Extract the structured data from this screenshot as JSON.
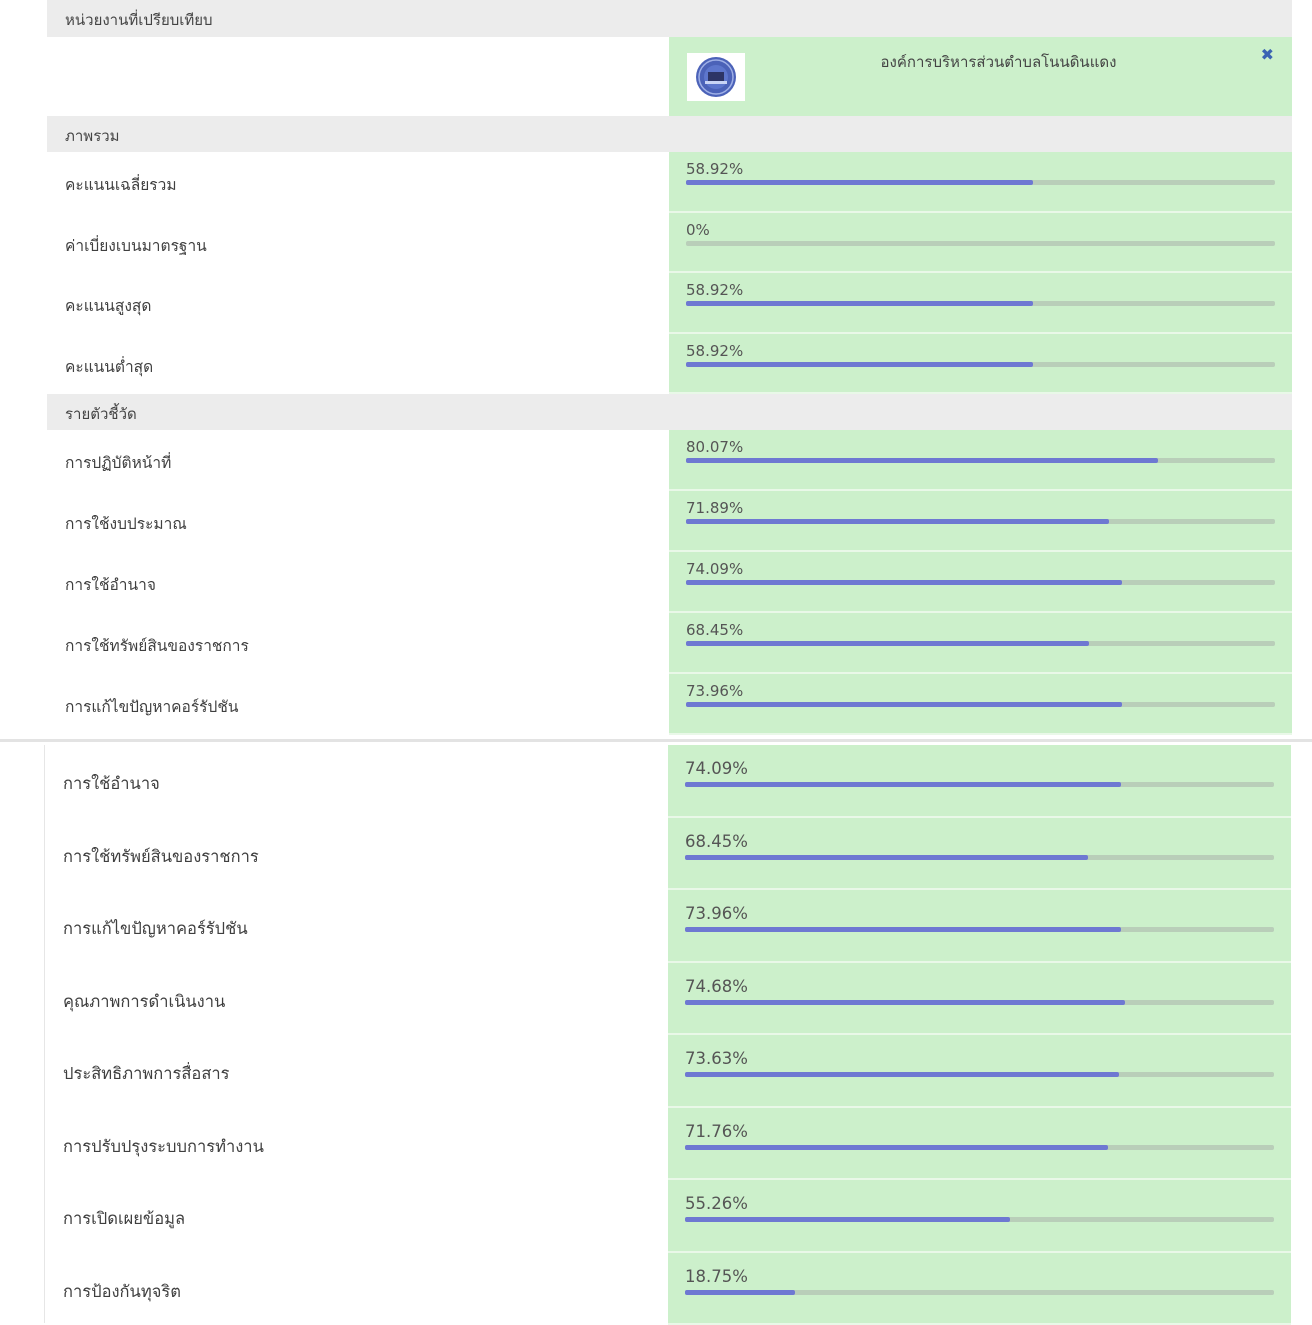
{
  "header": {
    "section_label": "หน่วยงานที่เปรียบเทียบ",
    "org_name": "องค์การบริหารส่วนตำบลโนนดินแดง",
    "close_icon": "close-icon"
  },
  "overview": {
    "title": "ภาพรวม",
    "rows": [
      {
        "label": "คะแนนเฉลี่ยรวม",
        "value": "58.92%",
        "fraction": 0.5892
      },
      {
        "label": "ค่าเบี่ยงเบนมาตรฐาน",
        "value": "0%",
        "fraction": 0
      },
      {
        "label": "คะแนนสูงสุด",
        "value": "58.92%",
        "fraction": 0.5892
      },
      {
        "label": "คะแนนต่ำสุด",
        "value": "58.92%",
        "fraction": 0.5892
      }
    ]
  },
  "indicators": {
    "title": "รายตัวชี้วัด",
    "rows": [
      {
        "label": "การปฏิบัติหน้าที่",
        "value": "80.07%",
        "fraction": 0.8007
      },
      {
        "label": "การใช้งบประมาณ",
        "value": "71.89%",
        "fraction": 0.7189
      },
      {
        "label": "การใช้อำนาจ",
        "value": "74.09%",
        "fraction": 0.7409
      },
      {
        "label": "การใช้ทรัพย์สินของราชการ",
        "value": "68.45%",
        "fraction": 0.6845
      },
      {
        "label": "การแก้ไขปัญหาคอร์รัปชัน",
        "value": "73.96%",
        "fraction": 0.7396
      }
    ]
  },
  "indicators_continued": {
    "rows": [
      {
        "label": "การใช้อำนาจ",
        "value": "74.09%",
        "fraction": 0.7409
      },
      {
        "label": "การใช้ทรัพย์สินของราชการ",
        "value": "68.45%",
        "fraction": 0.6845
      },
      {
        "label": "การแก้ไขปัญหาคอร์รัปชัน",
        "value": "73.96%",
        "fraction": 0.7396
      },
      {
        "label": "คุณภาพการดำเนินงาน",
        "value": "74.68%",
        "fraction": 0.7468
      },
      {
        "label": "ประสิทธิภาพการสื่อสาร",
        "value": "73.63%",
        "fraction": 0.7363
      },
      {
        "label": "การปรับปรุงระบบการทำงาน",
        "value": "71.76%",
        "fraction": 0.7176
      },
      {
        "label": "การเปิดเผยข้อมูล",
        "value": "55.26%",
        "fraction": 0.5526
      },
      {
        "label": "การป้องกันทุจริต",
        "value": "18.75%",
        "fraction": 0.1875
      }
    ]
  },
  "colors": {
    "bar_fill": "#6e78d2",
    "bar_track": "#b9ceb9",
    "cell_green": "#ccf0cb",
    "header_gray": "#ececec"
  }
}
